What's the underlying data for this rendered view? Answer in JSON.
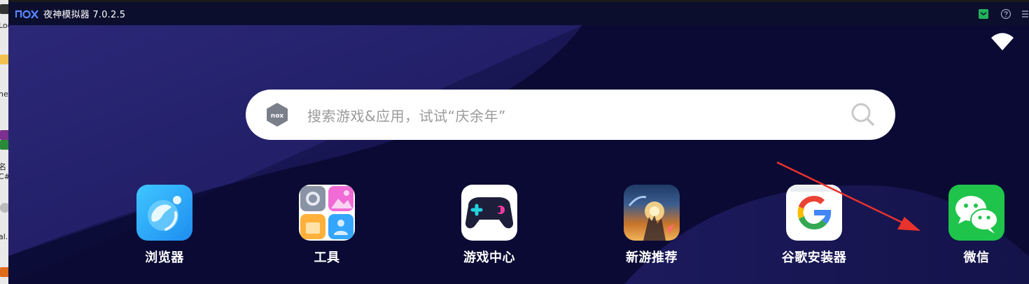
{
  "desktop": {
    "labels": [
      "Log",
      "ne",
      "名",
      "C#",
      "al.b"
    ]
  },
  "window": {
    "title": "夜神模拟器 7.0.2.5",
    "brand_icon": "nox-logo",
    "toolbar_icons": [
      "mail-icon",
      "help-icon",
      "menu-icon"
    ]
  },
  "status": {
    "wifi_icon": "wifi-icon"
  },
  "search": {
    "placeholder": "搜索游戏&应用，试试“庆余年”",
    "left_icon": "nox-hex-icon",
    "right_icon": "search-icon"
  },
  "apps": [
    {
      "label": "浏览器",
      "icon": "browser-icon"
    },
    {
      "label": "工具",
      "icon": "tools-icon"
    },
    {
      "label": "游戏中心",
      "icon": "game-center-icon"
    },
    {
      "label": "新游推荐",
      "icon": "new-games-icon"
    },
    {
      "label": "谷歌安装器",
      "icon": "google-installer-icon"
    },
    {
      "label": "微信",
      "icon": "wechat-icon"
    }
  ],
  "annotation": {
    "type": "arrow",
    "color": "#e8332d",
    "points_to": "微信"
  },
  "colors": {
    "titlebar": "#0c0e2e",
    "background": "#0a0a36",
    "accent_green": "#23b25a",
    "wechat_green": "#07c160"
  }
}
